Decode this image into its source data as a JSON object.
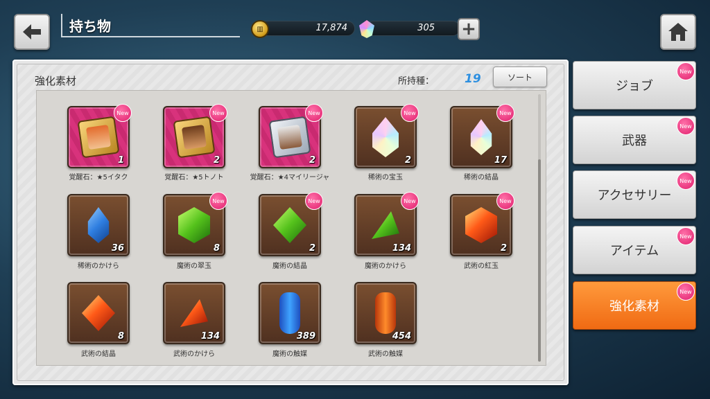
{
  "header": {
    "title": "持ち物",
    "gold_icon_text": "▥",
    "gold_value": "17,874",
    "gem_value": "305",
    "plus_label": "+"
  },
  "panel": {
    "section_title": "強化素材",
    "owned_label": "所持種：",
    "owned_count": "19",
    "sort_label": "ソート"
  },
  "new_label": "New",
  "items": [
    {
      "label": "覚醒石：★5イタク",
      "count": "1"
    },
    {
      "label": "覚醒石：★5トノト",
      "count": "2"
    },
    {
      "label": "覚醒石：★4マイリージャ",
      "count": "2"
    },
    {
      "label": "稀術の宝玉",
      "count": "2"
    },
    {
      "label": "稀術の結晶",
      "count": "17"
    },
    {
      "label": "稀術のかけら",
      "count": "36"
    },
    {
      "label": "魔術の翠玉",
      "count": "8"
    },
    {
      "label": "魔術の結晶",
      "count": "2"
    },
    {
      "label": "魔術のかけら",
      "count": "134"
    },
    {
      "label": "武術の紅玉",
      "count": "2"
    },
    {
      "label": "武術の結晶",
      "count": "8"
    },
    {
      "label": "武術のかけら",
      "count": "134"
    },
    {
      "label": "魔術の触媒",
      "count": "389"
    },
    {
      "label": "武術の触媒",
      "count": "454"
    }
  ],
  "tabs": [
    {
      "label": "ジョブ"
    },
    {
      "label": "武器"
    },
    {
      "label": "アクセサリー"
    },
    {
      "label": "アイテム"
    },
    {
      "label": "強化素材"
    }
  ],
  "colors": {
    "active_tab": "#f06a13",
    "new_badge": "#e0206d",
    "owned_count": "#2d8fe0"
  }
}
